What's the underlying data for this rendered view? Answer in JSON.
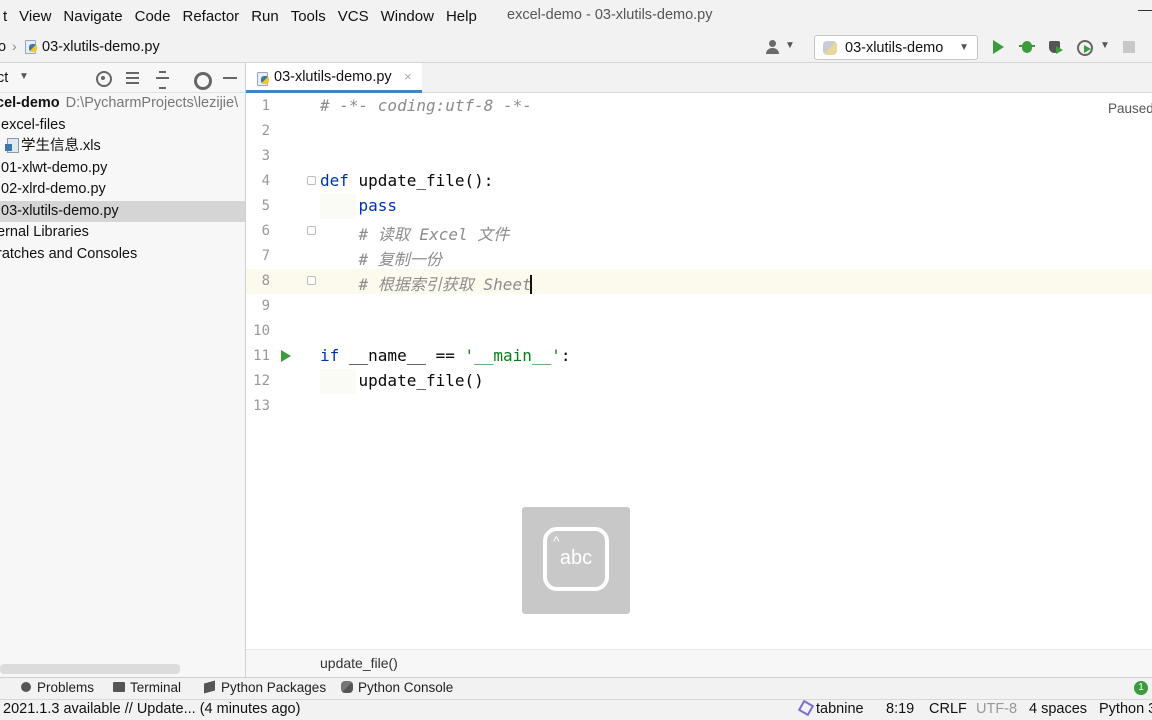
{
  "menubar": {
    "items": [
      "t",
      "View",
      "Navigate",
      "Code",
      "Refactor",
      "Run",
      "Tools",
      "VCS",
      "Window",
      "Help"
    ],
    "title": "excel-demo - 03-xlutils-demo.py"
  },
  "navbar": {
    "project_crumb": "o",
    "file_crumb": "03-xlutils-demo.py",
    "run_config": "03-xlutils-demo"
  },
  "project_panel": {
    "title": "ct",
    "tree": [
      {
        "label": "cel-demo",
        "path": "D:\\PycharmProjects\\lezijie\\",
        "bold": true
      },
      {
        "label": "excel-files"
      },
      {
        "label": "学生信息.xls",
        "icon": "xls-file-icon"
      },
      {
        "label": "01-xlwt-demo.py"
      },
      {
        "label": "02-xlrd-demo.py"
      },
      {
        "label": "03-xlutils-demo.py",
        "selected": true
      },
      {
        "label": "ernal Libraries"
      },
      {
        "label": "ratches and Consoles"
      }
    ]
  },
  "editor": {
    "tab_label": "03-xlutils-demo.py",
    "tab_close": "×",
    "status": "Paused",
    "lines": [
      {
        "num": "1",
        "parts": [
          {
            "t": "# -*- coding:utf-8 -*-",
            "c": "comment"
          }
        ]
      },
      {
        "num": "2",
        "parts": []
      },
      {
        "num": "3",
        "parts": []
      },
      {
        "num": "4",
        "parts": [
          {
            "t": "def",
            "c": "kw"
          },
          {
            "t": " update_file():",
            "c": ""
          }
        ]
      },
      {
        "num": "5",
        "parts": [
          {
            "t": "    ",
            "c": ""
          },
          {
            "t": "pass",
            "c": "kw-pass"
          }
        ]
      },
      {
        "num": "6",
        "parts": [
          {
            "t": "    ",
            "c": ""
          },
          {
            "t": "# 读取 Excel 文件",
            "c": "comment"
          }
        ]
      },
      {
        "num": "7",
        "parts": [
          {
            "t": "    ",
            "c": ""
          },
          {
            "t": "# 复制一份",
            "c": "comment"
          }
        ]
      },
      {
        "num": "8",
        "parts": [
          {
            "t": "    ",
            "c": ""
          },
          {
            "t": "# 根据索引获取 Sheet",
            "c": "comment"
          }
        ]
      },
      {
        "num": "9",
        "parts": []
      },
      {
        "num": "10",
        "parts": []
      },
      {
        "num": "11",
        "parts": [
          {
            "t": "if",
            "c": "kw"
          },
          {
            "t": " __name__ == ",
            "c": ""
          },
          {
            "t": "'__main__'",
            "c": "str"
          },
          {
            "t": ":",
            "c": ""
          }
        ]
      },
      {
        "num": "12",
        "parts": [
          {
            "t": "    update_file()",
            "c": ""
          }
        ]
      },
      {
        "num": "13",
        "parts": []
      }
    ],
    "breadcrumb": "update_file()"
  },
  "ime": {
    "label": "abc"
  },
  "tool_windows": [
    {
      "label": "Problems",
      "icon": "problems-icon"
    },
    {
      "label": "Terminal",
      "icon": "terminal-icon"
    },
    {
      "label": "Python Packages",
      "icon": "packages-icon"
    },
    {
      "label": "Python Console",
      "icon": "python-console-icon"
    }
  ],
  "event_badge": "1",
  "statusbar": {
    "message": "2021.1.3 available // Update... (4 minutes ago)",
    "tabnine": "tabnine",
    "position": "8:19",
    "line_sep": "CRLF",
    "encoding": "UTF-8",
    "indent": "4 spaces",
    "interpreter": "Python 3"
  },
  "colors": {
    "accent": "#4083c9",
    "run_green": "#3c9b3c",
    "keyword": "#0033b3",
    "string": "#067d17",
    "comment": "#8c8c8c"
  }
}
